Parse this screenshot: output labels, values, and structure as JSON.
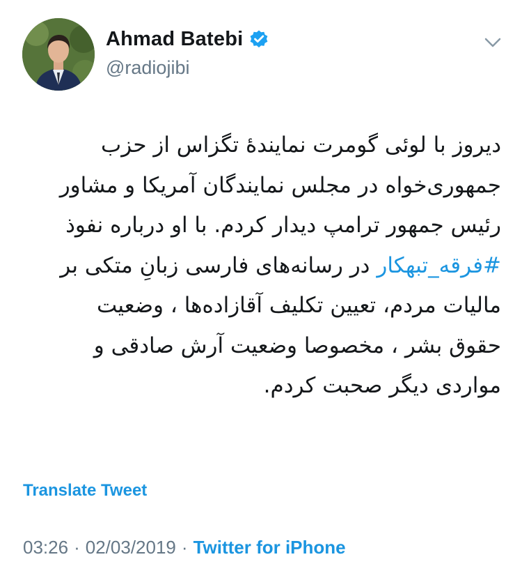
{
  "author": {
    "display_name": "Ahmad Batebi",
    "handle": "@radiojibi"
  },
  "tweet": {
    "text_before": "دیروز با لوئی گومرت نمایندهٔ تگزاس از حزب جمهوری‌خواه در مجلس نمایندگان آمریکا و مشاور رئیس جمهور ترامپ دیدار کردم. با او درباره نفوذ ",
    "hashtag": "#فرقه_تبهکار",
    "text_after": " در رسانه‌های فارسی زبانِ متکی بر مالیات مردم، تعیین تکلیف آقازاده‌ها ، وضعیت حقوق بشر ، مخصوصا وضعیت آرش صادقی و مواردی دیگر صحبت کردم."
  },
  "translate_label": "Translate Tweet",
  "meta": {
    "time": "03:26",
    "separator": "·",
    "date": "02/03/2019",
    "source": "Twitter for iPhone"
  },
  "icons": {
    "verified": "verified-badge-icon",
    "menu": "chevron-down-icon"
  },
  "colors": {
    "link": "#1b95e0",
    "secondary_text": "#657786",
    "primary_text": "#14171a",
    "verified": "#1da1f2"
  }
}
